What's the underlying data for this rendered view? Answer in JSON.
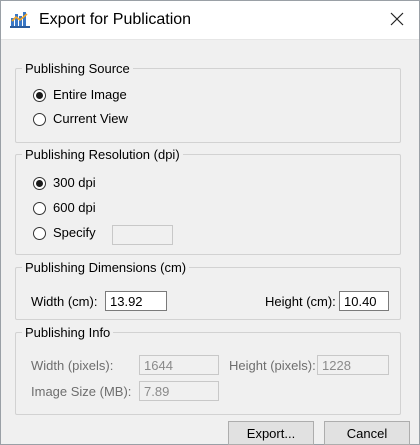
{
  "window": {
    "title": "Export for Publication",
    "icon": "chart-icon",
    "close_icon": "close-icon"
  },
  "source": {
    "legend": "Publishing Source",
    "options": [
      {
        "label": "Entire Image",
        "checked": true
      },
      {
        "label": "Current View",
        "checked": false
      }
    ]
  },
  "resolution": {
    "legend": "Publishing Resolution (dpi)",
    "options": [
      {
        "label": "300 dpi",
        "checked": true
      },
      {
        "label": "600 dpi",
        "checked": false
      },
      {
        "label": "Specify",
        "checked": false
      }
    ],
    "specify_value": ""
  },
  "dimensions": {
    "legend": "Publishing Dimensions (cm)",
    "width_label": "Width (cm):",
    "width_value": "13.92",
    "height_label": "Height (cm):",
    "height_value": "10.40"
  },
  "info": {
    "legend": "Publishing Info",
    "width_pixels_label": "Width (pixels):",
    "width_pixels_value": "1644",
    "height_pixels_label": "Height (pixels):",
    "height_pixels_value": "1228",
    "image_size_label": "Image Size (MB):",
    "image_size_value": "7.89"
  },
  "buttons": {
    "export_label": "Export...",
    "cancel_label": "Cancel"
  }
}
